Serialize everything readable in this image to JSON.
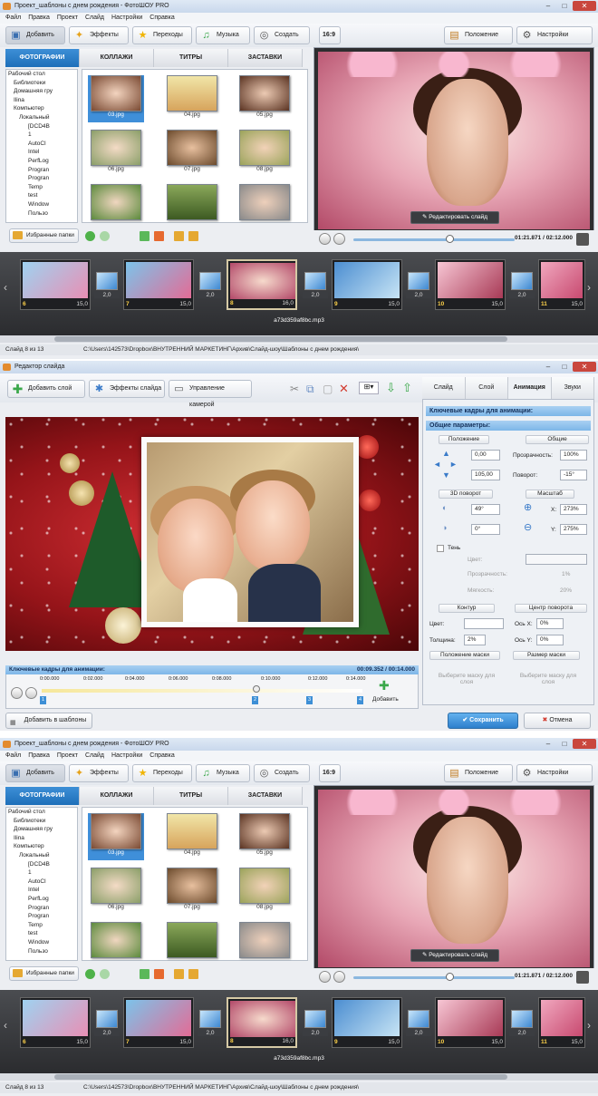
{
  "main_window": {
    "title": "Проект_шаблоны с днем рождения - ФотоШОУ PRO",
    "menu": [
      "Файл",
      "Правка",
      "Проект",
      "Слайд",
      "Настройки",
      "Справка"
    ],
    "toolbar": {
      "add": "Добавить",
      "effects": "Эффекты",
      "transitions": "Переходы",
      "music": "Музыка",
      "create": "Создать",
      "ratio": "16:9",
      "photo_position": "Положение фото",
      "project_settings": "Настройки проекта"
    },
    "tabs": [
      "ФОТОГРАФИИ",
      "КОЛЛАЖИ",
      "ТИТРЫ",
      "ЗАСТАВКИ"
    ],
    "tree": [
      "Рабочий стол",
      "Библиотеки",
      "Домашняя гру",
      "Ilina",
      "Компьютер",
      "Локальный",
      "[DCD4B",
      "1",
      "AutoCl",
      "Intel",
      "PerfLog",
      "Progran",
      "Progran",
      "Temp",
      "test",
      "Window",
      "Пользо"
    ],
    "thumbs": [
      "03.jpg",
      "04.jpg",
      "05.jpg",
      "06.jpg",
      "07.jpg",
      "08.jpg",
      "",
      "",
      ""
    ],
    "favorites": "Избранные папки",
    "edit_slide": "Редактировать слайд",
    "time": "01:21.871 / 02:12.000",
    "slides": [
      {
        "n": "6",
        "d": "15,0"
      },
      {
        "n": "7",
        "d": "15,0"
      },
      {
        "n": "8",
        "d": "16,0"
      },
      {
        "n": "9",
        "d": "15,0"
      },
      {
        "n": "10",
        "d": "15,0"
      },
      {
        "n": "11",
        "d": "15,0"
      }
    ],
    "transitions": [
      "2,0",
      "2,0",
      "2,0",
      "2,0",
      "2,0"
    ],
    "audio": "a73d359af8bc.mp3",
    "status_slide": "Слайд 8 из 13",
    "status_path": "C:\\Users\\142573\\Dropbox\\ВНУТРЕННИЙ МАРКЕТИНГ\\Архив\\Слайд-шоу\\Шаблоны с днем рождения\\"
  },
  "editor": {
    "title": "Редактор слайда",
    "add_layer": "Добавить слой",
    "slide_effects": "Эффекты слайда",
    "camera": "Управление камерой",
    "tabs": [
      "Слайд",
      "Слой",
      "Анимация",
      "Звуки"
    ],
    "keyframes_header": "Ключевые кадры для анимации:",
    "general_header": "Общие параметры:",
    "position": "Положение",
    "general": "Общие",
    "pos_x": "0,00",
    "pos_y": "105,00",
    "transparency_label": "Прозрачность:",
    "transparency": "100%",
    "rotation_label": "Поворот:",
    "rotation": "-15°",
    "rot3d": "3D поворот",
    "scale": "Масштаб",
    "rot3d_a": "49°",
    "rot3d_b": "0°",
    "scale_x_label": "X:",
    "scale_x": "273%",
    "scale_y_label": "Y:",
    "scale_y": "275%",
    "shadow": "Тень",
    "shadow_color": "Цвет:",
    "shadow_transp": "Прозрачность:",
    "shadow_transp_v": "1%",
    "shadow_soft": "Мягкость:",
    "shadow_soft_v": "20%",
    "contour": "Контур",
    "rot_center": "Центр поворота",
    "color": "Цвет:",
    "thickness": "Толщина:",
    "thickness_v": "2%",
    "axis_x": "Ось X:",
    "axis_x_v": "0%",
    "axis_y": "Ось Y:",
    "axis_y_v": "0%",
    "mask_pos": "Положение маски",
    "mask_size": "Размер маски",
    "choose_mask": "Выберите маску для слоя",
    "timeline_header": "Ключевые кадры для анимации:",
    "timeline_time": "00:09.352 / 00:14.000",
    "ticks": [
      "0:00.000",
      "0:02.000",
      "0:04.000",
      "0:06.000",
      "0:08.000",
      "0:10.000",
      "0:12.000",
      "0:14.000"
    ],
    "keys": [
      "1",
      "2",
      "3",
      "4"
    ],
    "add": "Добавить",
    "add_templates": "Добавить в шаблоны",
    "save": "Сохранить",
    "cancel": "Отмена"
  },
  "colors": {
    "accent": "#2d7fcc",
    "tab_active": "#1e6fb9",
    "strip": "#2b2c2f"
  }
}
